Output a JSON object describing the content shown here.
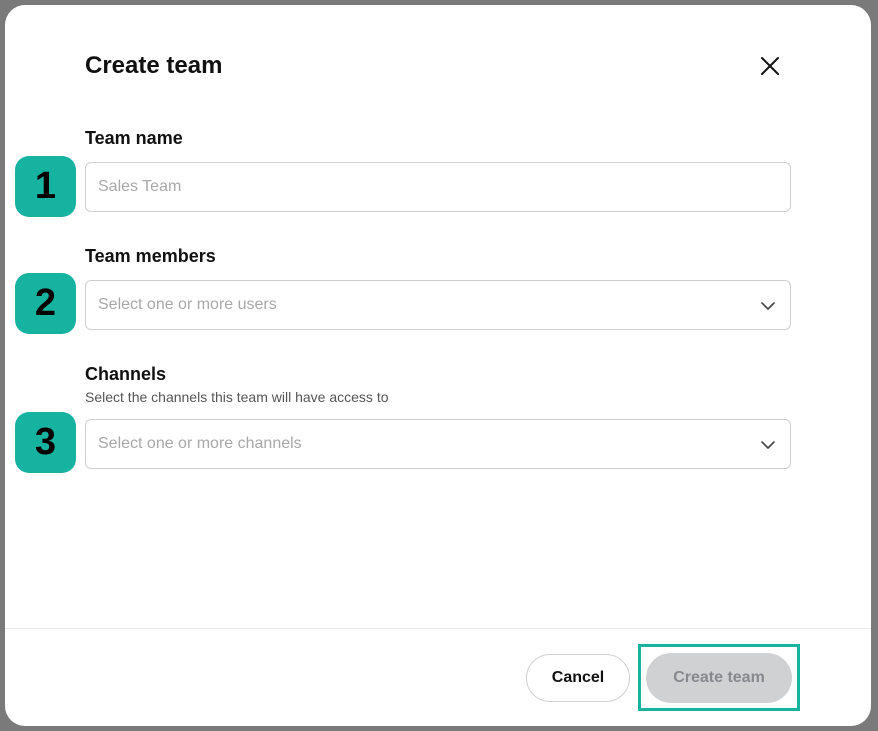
{
  "dialog": {
    "title": "Create team",
    "close_icon": "close-icon"
  },
  "fields": {
    "team_name": {
      "label": "Team name",
      "placeholder": "Sales Team",
      "value": ""
    },
    "team_members": {
      "label": "Team members",
      "placeholder": "Select one or more users",
      "icon": "chevron-down-icon"
    },
    "channels": {
      "label": "Channels",
      "helper": "Select the channels this team will have access to",
      "placeholder": "Select one or more channels",
      "icon": "chevron-down-icon"
    }
  },
  "step_badges": [
    "1",
    "2",
    "3"
  ],
  "footer": {
    "cancel_label": "Cancel",
    "create_label": "Create team"
  },
  "colors": {
    "accent": "#16b3a0",
    "overlay": "#7a7a7a",
    "disabled_button_bg": "#cfd1d3",
    "disabled_button_text": "#868a8e"
  }
}
